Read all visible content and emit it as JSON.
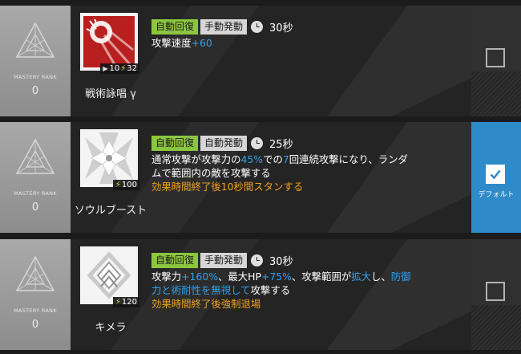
{
  "skills": [
    {
      "mastery_label": "MASTERY RANK",
      "mastery_value": "0",
      "name": "戦術詠唱 γ",
      "icon": "broken-shield-icon",
      "initial_sp": "10",
      "sp_cost": "32",
      "recovery": "自動回復",
      "activation": "手動発動",
      "duration": "30秒",
      "description_lines": [
        [
          {
            "t": "攻撃速度"
          },
          {
            "t": "+60",
            "c": "blue"
          }
        ]
      ],
      "selected": false,
      "default_label": ""
    },
    {
      "mastery_label": "MASTERY RANK",
      "mastery_value": "0",
      "name": "ソウルブースト",
      "icon": "crystal-burst-icon",
      "sp_cost": "100",
      "recovery": "自動回復",
      "activation": "自動発動",
      "duration": "25秒",
      "description_lines": [
        [
          {
            "t": "通常攻撃が攻撃力の"
          },
          {
            "t": "45%",
            "c": "blue"
          },
          {
            "t": "での"
          },
          {
            "t": "7",
            "c": "blue"
          },
          {
            "t": "回連続攻撃になり、ランダ"
          }
        ],
        [
          {
            "t": "ムで範囲内の敵を攻撃する"
          }
        ],
        [
          {
            "t": "効果時間終了後10秒間スタンする",
            "c": "orange"
          }
        ]
      ],
      "selected": true,
      "default_label": "デフォルト"
    },
    {
      "mastery_label": "MASTERY RANK",
      "mastery_value": "0",
      "name": "キメラ",
      "icon": "chimera-diamond-icon",
      "sp_cost": "120",
      "recovery": "自動回復",
      "activation": "手動発動",
      "duration": "30秒",
      "description_lines": [
        [
          {
            "t": "攻撃力"
          },
          {
            "t": "+160%",
            "c": "blue"
          },
          {
            "t": "、最大HP"
          },
          {
            "t": "+75%",
            "c": "blue"
          },
          {
            "t": "、攻撃範囲が"
          },
          {
            "t": "拡大",
            "c": "blue"
          },
          {
            "t": "し、"
          },
          {
            "t": "防御",
            "c": "blue"
          }
        ],
        [
          {
            "t": "力と術耐性を無視して",
            "c": "blue"
          },
          {
            "t": "攻撃する"
          }
        ],
        [
          {
            "t": "効果時間終了後強制退場",
            "c": "orange"
          }
        ]
      ],
      "selected": false,
      "default_label": ""
    }
  ]
}
